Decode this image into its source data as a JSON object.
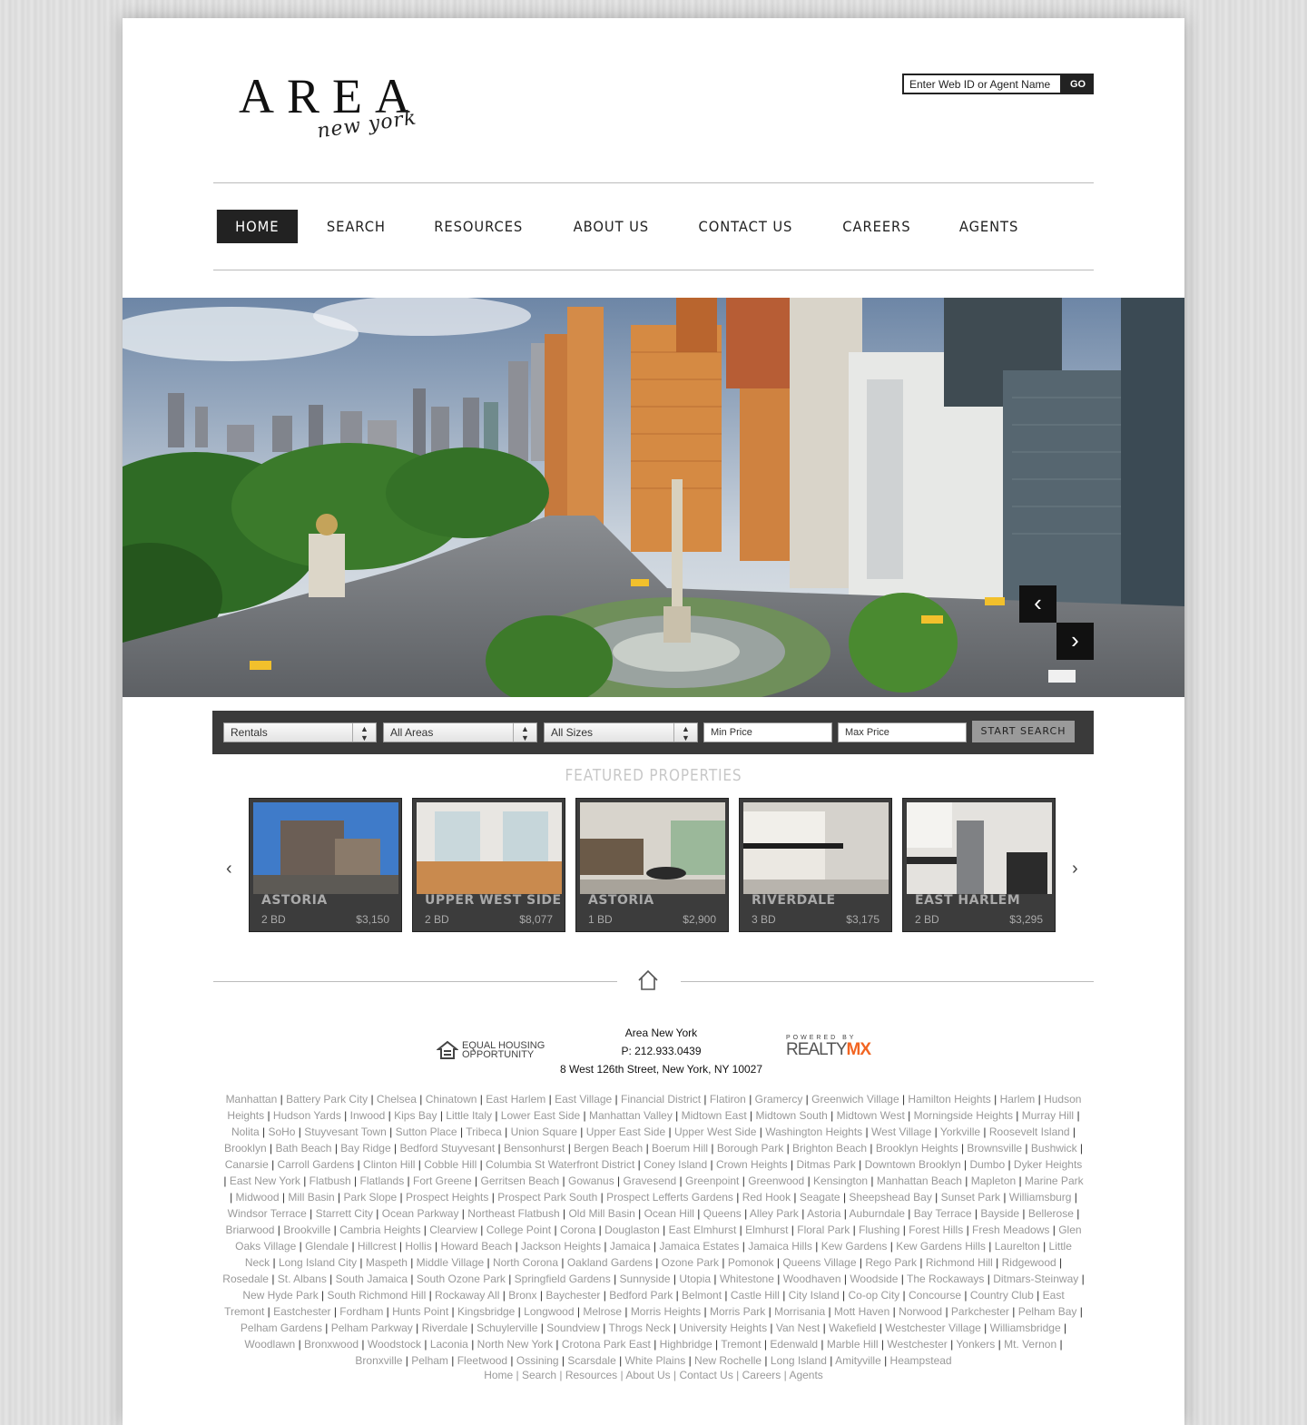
{
  "header": {
    "logo_main": "AREA",
    "logo_sub": "new york",
    "search_placeholder": "Enter Web ID or Agent Name",
    "go_label": "GO"
  },
  "nav": {
    "items": [
      "HOME",
      "SEARCH",
      "RESOURCES",
      "ABOUT US",
      "CONTACT US",
      "CAREERS",
      "AGENTS"
    ],
    "active": "HOME"
  },
  "hero": {
    "prev_icon": "chevron-left-icon",
    "next_icon": "chevron-right-icon"
  },
  "search_bar": {
    "type_value": "Rentals",
    "area_value": "All Areas",
    "size_value": "All Sizes",
    "min_price_placeholder": "Min Price",
    "max_price_placeholder": "Max Price",
    "button_label": "START SEARCH"
  },
  "featured": {
    "title": "FEATURED PROPERTIES",
    "prev_arrow": "‹",
    "next_arrow": "›",
    "properties": [
      {
        "area": "ASTORIA",
        "beds": "2 BD",
        "price": "$3,150"
      },
      {
        "area": "UPPER WEST SIDE",
        "beds": "2 BD",
        "price": "$8,077"
      },
      {
        "area": "ASTORIA",
        "beds": "1 BD",
        "price": "$2,900"
      },
      {
        "area": "RIVERDALE",
        "beds": "3 BD",
        "price": "$3,175"
      },
      {
        "area": "EAST HARLEM",
        "beds": "2 BD",
        "price": "$3,295"
      }
    ]
  },
  "footer": {
    "eho_line1": "EQUAL HOUSING",
    "eho_line2": "OPPORTUNITY",
    "company": "Area New York",
    "phone": "P: 212.933.0439",
    "address": "8 West 126th Street, New York, NY 10027",
    "powered_by": "POWERED BY",
    "realty_a": "REALTY",
    "realty_b": "MX",
    "neighborhoods": [
      "Manhattan",
      "Battery Park City",
      "Chelsea",
      "Chinatown",
      "East Harlem",
      "East Village",
      "Financial District",
      "Flatiron",
      "Gramercy",
      "Greenwich Village",
      "Hamilton Heights",
      "Harlem",
      "Hudson Heights",
      "Hudson Yards",
      "Inwood",
      "Kips Bay",
      "Little Italy",
      "Lower East Side",
      "Manhattan Valley",
      "Midtown East",
      "Midtown South",
      "Midtown West",
      "Morningside Heights",
      "Murray Hill",
      "Nolita",
      "SoHo",
      "Stuyvesant Town",
      "Sutton Place",
      "Tribeca",
      "Union Square",
      "Upper East Side",
      "Upper West Side",
      "Washington Heights",
      "West Village",
      "Yorkville",
      "Roosevelt Island",
      "Brooklyn",
      "Bath Beach",
      "Bay Ridge",
      "Bedford Stuyvesant",
      "Bensonhurst",
      "Bergen Beach",
      "Boerum Hill",
      "Borough Park",
      "Brighton Beach",
      "Brooklyn Heights",
      "Brownsville",
      "Bushwick",
      "Canarsie",
      "Carroll Gardens",
      "Clinton Hill",
      "Cobble Hill",
      "Columbia St Waterfront District",
      "Coney Island",
      "Crown Heights",
      "Ditmas Park",
      "Downtown Brooklyn",
      "Dumbo",
      "Dyker Heights",
      "East New York",
      "Flatbush",
      "Flatlands",
      "Fort Greene",
      "Gerritsen Beach",
      "Gowanus",
      "Gravesend",
      "Greenpoint",
      "Greenwood",
      "Kensington",
      "Manhattan Beach",
      "Mapleton",
      "Marine Park",
      "Midwood",
      "Mill Basin",
      "Park Slope",
      "Prospect Heights",
      "Prospect Park South",
      "Prospect Lefferts Gardens",
      "Red Hook",
      "Seagate",
      "Sheepshead Bay",
      "Sunset Park",
      "Williamsburg",
      "Windsor Terrace",
      "Starrett City",
      "Ocean Parkway",
      "Northeast Flatbush",
      "Old Mill Basin",
      "Ocean Hill",
      "Queens",
      "Alley Park",
      "Astoria",
      "Auburndale",
      "Bay Terrace",
      "Bayside",
      "Bellerose",
      "Briarwood",
      "Brookville",
      "Cambria Heights",
      "Clearview",
      "College Point",
      "Corona",
      "Douglaston",
      "East Elmhurst",
      "Elmhurst",
      "Floral Park",
      "Flushing",
      "Forest Hills",
      "Fresh Meadows",
      "Glen Oaks Village",
      "Glendale",
      "Hillcrest",
      "Hollis",
      "Howard Beach",
      "Jackson Heights",
      "Jamaica",
      "Jamaica Estates",
      "Jamaica Hills",
      "Kew Gardens",
      "Kew Gardens Hills",
      "Laurelton",
      "Little Neck",
      "Long Island City",
      "Maspeth",
      "Middle Village",
      "North Corona",
      "Oakland Gardens",
      "Ozone Park",
      "Pomonok",
      "Queens Village",
      "Rego Park",
      "Richmond Hill",
      "Ridgewood",
      "Rosedale",
      "St. Albans",
      "South Jamaica",
      "South Ozone Park",
      "Springfield Gardens",
      "Sunnyside",
      "Utopia",
      "Whitestone",
      "Woodhaven",
      "Woodside",
      "The Rockaways",
      "Ditmars-Steinway",
      "New Hyde Park",
      "South Richmond Hill",
      "Rockaway All",
      "Bronx",
      "Baychester",
      "Bedford Park",
      "Belmont",
      "Castle Hill",
      "City Island",
      "Co-op City",
      "Concourse",
      "Country Club",
      "East Tremont",
      "Eastchester",
      "Fordham",
      "Hunts Point",
      "Kingsbridge",
      "Longwood",
      "Melrose",
      "Morris Heights",
      "Morris Park",
      "Morrisania",
      "Mott Haven",
      "Norwood",
      "Parkchester",
      "Pelham Bay",
      "Pelham Gardens",
      "Pelham Parkway",
      "Riverdale",
      "Schuylerville",
      "Soundview",
      "Throgs Neck",
      "University Heights",
      "Van Nest",
      "Wakefield",
      "Westchester Village",
      "Williamsbridge",
      "Woodlawn",
      "Bronxwood",
      "Woodstock",
      "Laconia",
      "North New York",
      "Crotona Park East",
      "Highbridge",
      "Tremont",
      "Edenwald",
      "Marble Hill",
      "Westchester",
      "Yonkers",
      "Mt. Vernon",
      "Bronxville",
      "Pelham",
      "Fleetwood",
      "Ossining",
      "Scarsdale",
      "White Plains",
      "New Rochelle",
      "Long Island",
      "Amityville",
      "Heampstead"
    ],
    "bottom_nav": [
      "Home",
      "Search",
      "Resources",
      "About Us",
      "Contact Us",
      "Careers",
      "Agents"
    ]
  }
}
